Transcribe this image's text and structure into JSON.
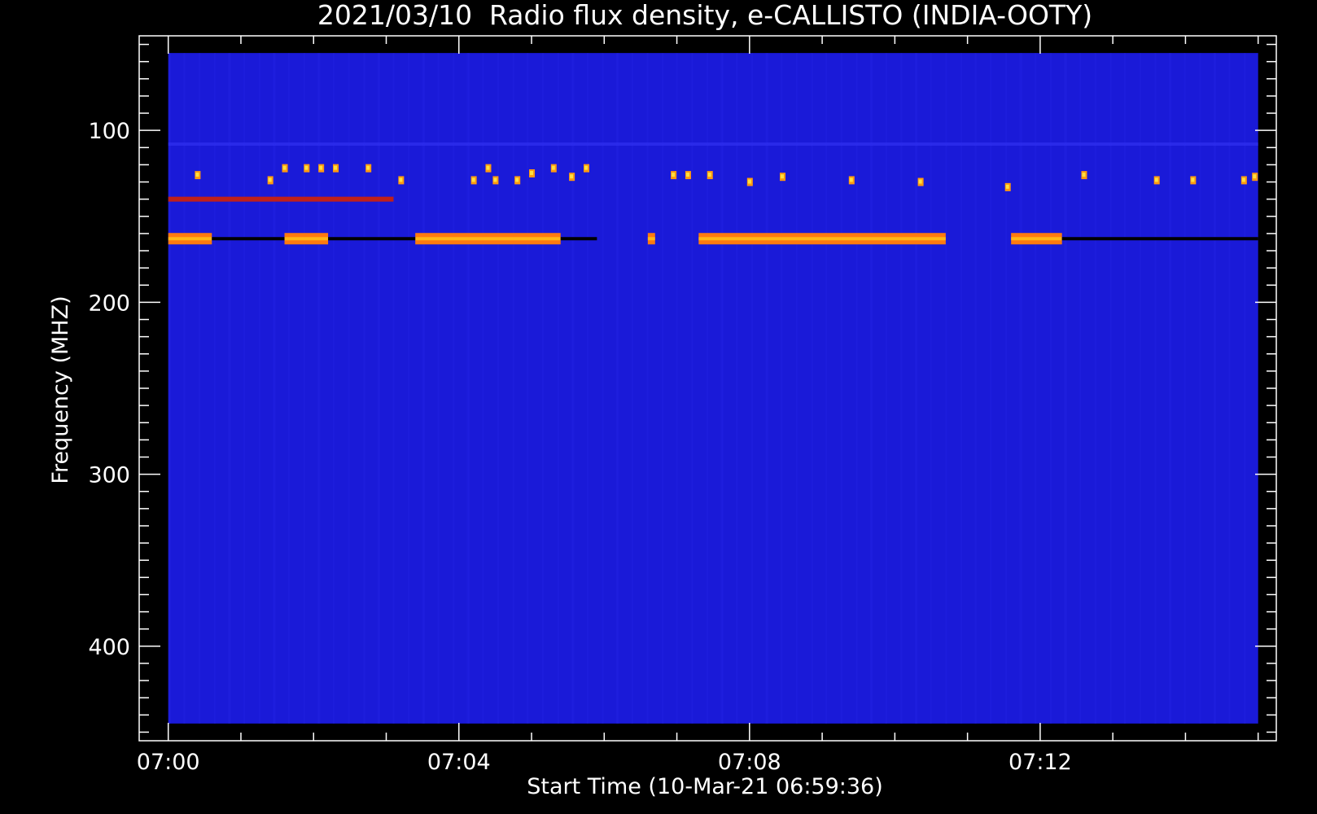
{
  "chart_data": {
    "type": "heatmap",
    "title": "2021/03/10  Radio flux density, e-CALLISTO (INDIA-OOTY)",
    "xlabel": "Start Time (10-Mar-21 06:59:36)",
    "ylabel": "Frequency (MHZ)",
    "x_range_minutes": [
      -0.4,
      15.25
    ],
    "data_x_range_minutes": [
      0,
      15.0
    ],
    "y_range_mhz": [
      45,
      455
    ],
    "data_y_range_mhz": [
      55,
      445
    ],
    "y_inverted": true,
    "x_tick_labels": [
      "07:00",
      "07:04",
      "07:08",
      "07:12"
    ],
    "x_tick_minutes": [
      0,
      4,
      8,
      12
    ],
    "x_minor_step_minutes": 1,
    "y_tick_labels": [
      "100",
      "200",
      "300",
      "400"
    ],
    "y_tick_values": [
      100,
      200,
      300,
      400
    ],
    "y_minor_step_mhz": 10,
    "background_color": "#1a1ad8",
    "colormap": [
      "#1a1ad8",
      "#8a1a9a",
      "#e0201a",
      "#ff7a10",
      "#ffd21a"
    ],
    "emission_lines": [
      {
        "freq_mhz": 108,
        "segments": [
          [
            0,
            15
          ]
        ],
        "color": "#3030f0",
        "kind": "faint"
      },
      {
        "freq_mhz": 140,
        "segments": [
          [
            0,
            3.1
          ]
        ],
        "color": "#c0201a",
        "kind": "band"
      },
      {
        "freq_mhz": 163,
        "segments": [
          [
            0,
            0.6
          ],
          [
            1.6,
            2.2
          ],
          [
            3.4,
            5.4
          ],
          [
            6.6,
            6.7
          ],
          [
            7.3,
            10.7
          ],
          [
            11.6,
            12.3
          ]
        ],
        "color": "#ff7a10",
        "kind": "burst"
      },
      {
        "freq_mhz": 163,
        "segments": [
          [
            0.6,
            1.6
          ],
          [
            2.2,
            3.4
          ],
          [
            5.4,
            5.9
          ],
          [
            12.3,
            15.0
          ]
        ],
        "color": "#000000",
        "kind": "dark"
      }
    ],
    "spikes": [
      {
        "t": 0.4,
        "f": 126
      },
      {
        "t": 1.4,
        "f": 129
      },
      {
        "t": 1.6,
        "f": 122
      },
      {
        "t": 1.9,
        "f": 122
      },
      {
        "t": 2.1,
        "f": 122
      },
      {
        "t": 2.3,
        "f": 122
      },
      {
        "t": 2.75,
        "f": 122
      },
      {
        "t": 3.2,
        "f": 129
      },
      {
        "t": 4.2,
        "f": 129
      },
      {
        "t": 4.5,
        "f": 129
      },
      {
        "t": 4.4,
        "f": 122
      },
      {
        "t": 4.8,
        "f": 129
      },
      {
        "t": 5.0,
        "f": 125
      },
      {
        "t": 5.3,
        "f": 122
      },
      {
        "t": 5.55,
        "f": 127
      },
      {
        "t": 5.75,
        "f": 122
      },
      {
        "t": 6.95,
        "f": 126
      },
      {
        "t": 7.15,
        "f": 126
      },
      {
        "t": 7.45,
        "f": 126
      },
      {
        "t": 8.0,
        "f": 130
      },
      {
        "t": 8.45,
        "f": 127
      },
      {
        "t": 9.4,
        "f": 129
      },
      {
        "t": 10.35,
        "f": 130
      },
      {
        "t": 11.55,
        "f": 133
      },
      {
        "t": 12.6,
        "f": 126
      },
      {
        "t": 13.6,
        "f": 129
      },
      {
        "t": 14.1,
        "f": 129
      },
      {
        "t": 14.8,
        "f": 129
      },
      {
        "t": 14.95,
        "f": 127
      }
    ]
  }
}
